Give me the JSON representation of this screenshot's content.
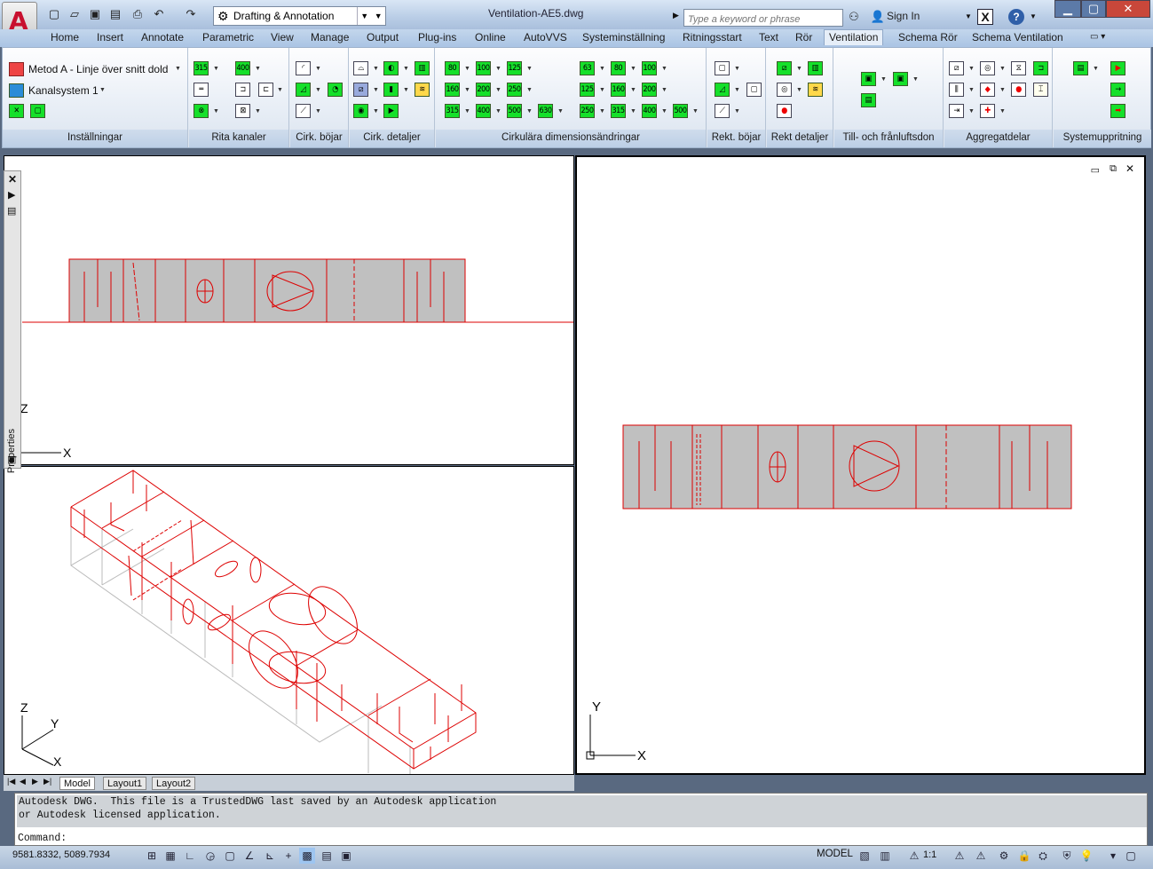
{
  "title_bar": {
    "app_logo": "A",
    "workspace": "Drafting & Annotation",
    "document": "Ventilation-AE5.dwg",
    "search_placeholder": "Type a keyword or phrase",
    "sign_in": "Sign In",
    "help": "?"
  },
  "ribbon_tabs": [
    "Home",
    "Insert",
    "Annotate",
    "Parametric",
    "View",
    "Manage",
    "Output",
    "Plug-ins",
    "Online",
    "AutoVVS",
    "Systeminställning",
    "Ritningsstart",
    "Text",
    "Rör",
    "Ventilation",
    "Schema Rör",
    "Schema Ventilation"
  ],
  "active_tab": "Ventilation",
  "settings": {
    "method": "Metod A - Linje över snitt dold",
    "duct_system": "Kanalsystem 1"
  },
  "ribbon_panels": [
    "Inställningar",
    "Rita kanaler",
    "Cirk. böjar",
    "Cirk. detaljer",
    "Cirkulära dimensionsändringar",
    "Rekt. böjar",
    "Rekt detaljer",
    "Till- och frånluftsdon",
    "Aggregatdelar",
    "Systemuppritning"
  ],
  "rita_kanaler_sizes": [
    "315",
    "400"
  ],
  "dimension_buttons": {
    "col1": [
      "80",
      "160",
      "315"
    ],
    "col2": [
      "100",
      "200",
      "400"
    ],
    "col3": [
      "125",
      "250",
      "500"
    ],
    "col3b": [
      "630"
    ],
    "col4": [
      "63",
      "125",
      "250"
    ],
    "col5": [
      "80",
      "160",
      "315"
    ],
    "col6": [
      "100",
      "200",
      "400"
    ],
    "col6b": [
      "500"
    ]
  },
  "properties_palette": {
    "label": "Properties"
  },
  "viewports": {
    "top_left": {
      "axis_z": "Z",
      "axis_x": "X"
    },
    "bottom_left": {
      "axis_z": "Z",
      "axis_y": "Y",
      "axis_x": "X"
    },
    "right": {
      "axis_y": "Y",
      "axis_x": "X"
    }
  },
  "layout_tabs": [
    "Model",
    "Layout1",
    "Layout2"
  ],
  "active_layout": "Model",
  "command": {
    "history_line1": "Autodesk DWG.  This file is a TrustedDWG last saved by an Autodesk application",
    "history_line2": "or Autodesk licensed application.",
    "prompt": "Command:"
  },
  "status": {
    "coordinates": "9581.8332, 5089.7934",
    "space": "MODEL",
    "scale": "1:1"
  },
  "colors": {
    "entity": "#dd0000",
    "unit_fill": "#c0c0c0",
    "button_green": "#15e02a"
  }
}
